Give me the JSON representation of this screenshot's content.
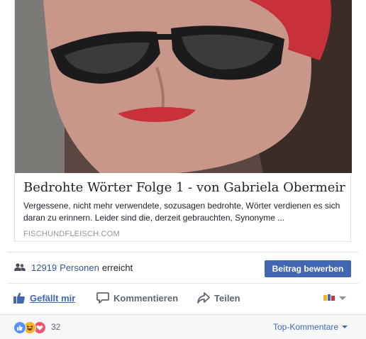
{
  "link_preview": {
    "title": "Bedrohte Wörter Folge 1 - von Gabriela Obermeir",
    "description": "Vergessene, nicht mehr verwendete, sozusagen bedrohte, Wörter verdienen es sich daran zu erinnern. Leider sind die, derzeit gebrauchten, Synonyme ...",
    "domain": "FISCHUNDFLEISCH.COM"
  },
  "reach": {
    "count": "12919",
    "people_label": "Personen",
    "suffix": "erreicht",
    "boost_button": "Beitrag bewerben"
  },
  "actions": {
    "like": "Gefällt mir",
    "comment": "Kommentieren",
    "share": "Teilen"
  },
  "reactions": {
    "count": "32",
    "sort_label": "Top-Kommentare"
  },
  "colors": {
    "facebook_blue": "#4267b2",
    "link_blue": "#365899",
    "like_blue": "#5890ff",
    "haha_yellow": "#f7b125",
    "love_red": "#f25268"
  }
}
